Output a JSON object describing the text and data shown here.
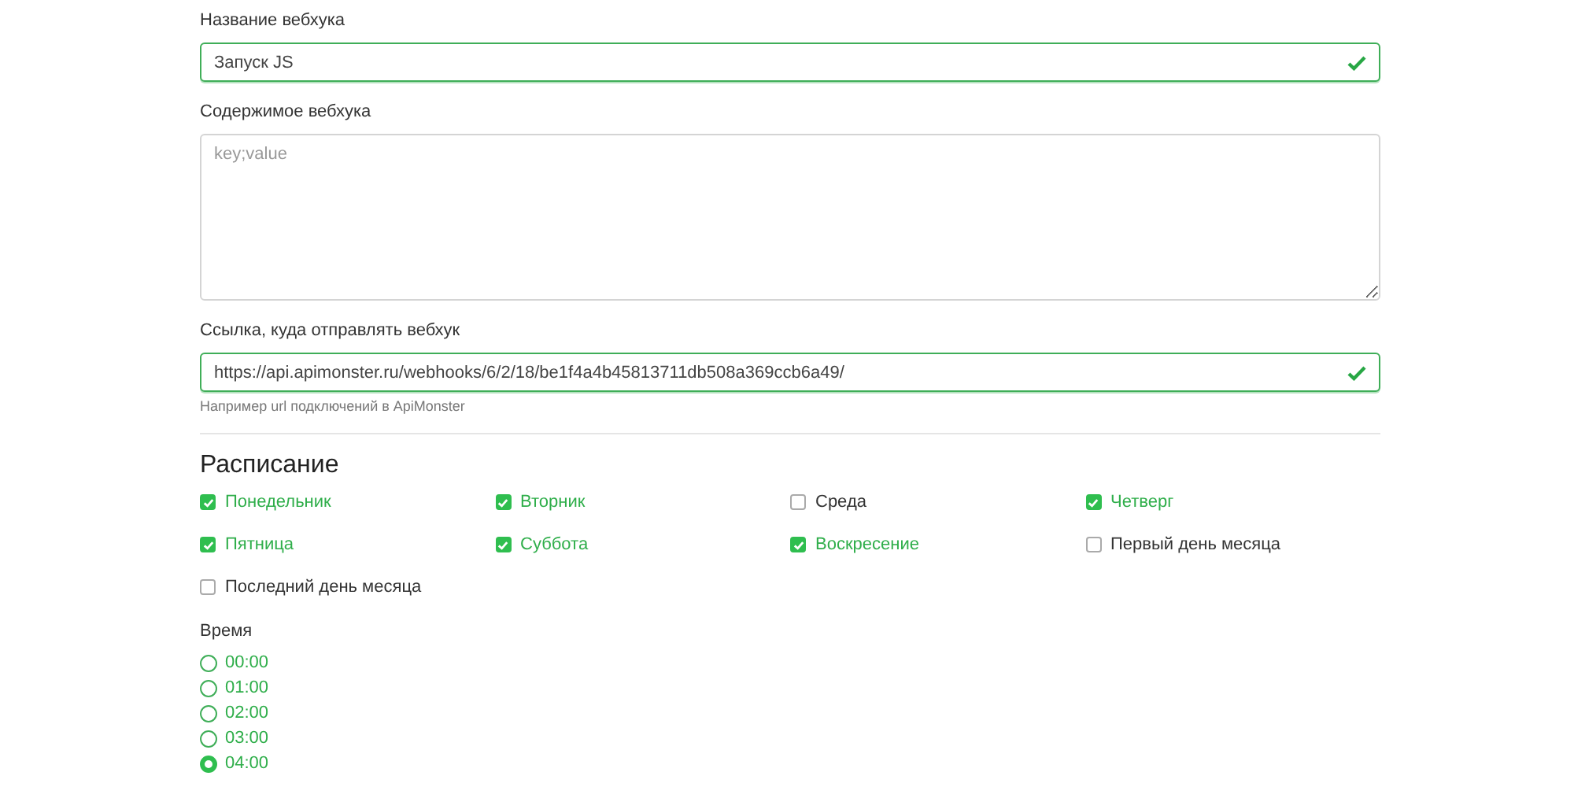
{
  "fields": [
    {
      "kind": "input",
      "label": "Название вебхука",
      "value": "Запуск JS",
      "valid": true
    },
    {
      "kind": "textarea",
      "label": "Содержимое вебхука",
      "placeholder": "key;value",
      "valid": false
    },
    {
      "kind": "input",
      "label": "Ссылка, куда отправлять вебхук",
      "value": "https://api.apimonster.ru/webhooks/6/2/18/be1f4a4b45813711db508a369ccb6a49/",
      "valid": true,
      "help": "Например url подключений в ApiMonster"
    }
  ],
  "schedule": {
    "title": "Расписание",
    "days": [
      {
        "label": "Понедельник",
        "checked": true
      },
      {
        "label": "Вторник",
        "checked": true
      },
      {
        "label": "Среда",
        "checked": false
      },
      {
        "label": "Четверг",
        "checked": true
      },
      {
        "label": "Пятница",
        "checked": true
      },
      {
        "label": "Суббота",
        "checked": true
      },
      {
        "label": "Воскресение",
        "checked": true
      },
      {
        "label": "Первый день месяца",
        "checked": false
      },
      {
        "label": "Последний день месяца",
        "checked": false
      }
    ]
  },
  "time": {
    "label": "Время",
    "options": [
      {
        "label": "00:00",
        "selected": false
      },
      {
        "label": "01:00",
        "selected": false
      },
      {
        "label": "02:00",
        "selected": false
      },
      {
        "label": "03:00",
        "selected": false
      },
      {
        "label": "04:00",
        "selected": true
      }
    ]
  }
}
